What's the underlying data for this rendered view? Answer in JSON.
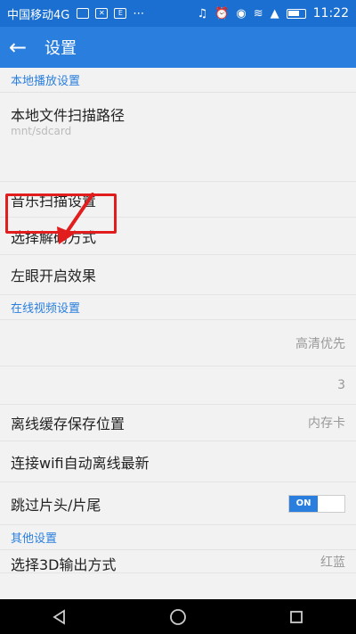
{
  "status_bar": {
    "carrier": "中国移动4G",
    "time": "11:22",
    "network": "4G"
  },
  "app_bar": {
    "title": "设置"
  },
  "sections": {
    "local": "本地播放设置",
    "online": "在线视频设置",
    "other": "其他设置"
  },
  "rows": {
    "scan_path": {
      "label": "本地文件扫描路径",
      "subtext": "mnt/sdcard"
    },
    "music_scan": {
      "label": "音乐扫描设置"
    },
    "decode_mode": {
      "label": "选择解码方式"
    },
    "left_eye": {
      "label": "左眼开启效果"
    },
    "quality": {
      "value": "高清优先"
    },
    "count": {
      "value": "3"
    },
    "cache_location": {
      "label": "离线缓存保存位置",
      "value": "内存卡"
    },
    "wifi_offline": {
      "label": "连接wifi自动离线最新"
    },
    "skip_intro": {
      "label": "跳过片头/片尾",
      "toggle": "ON"
    },
    "output_3d": {
      "label": "选择3D输出方式",
      "value": "红蓝"
    }
  },
  "colors": {
    "accent": "#2a7fde",
    "highlight": "#e21d1d"
  }
}
